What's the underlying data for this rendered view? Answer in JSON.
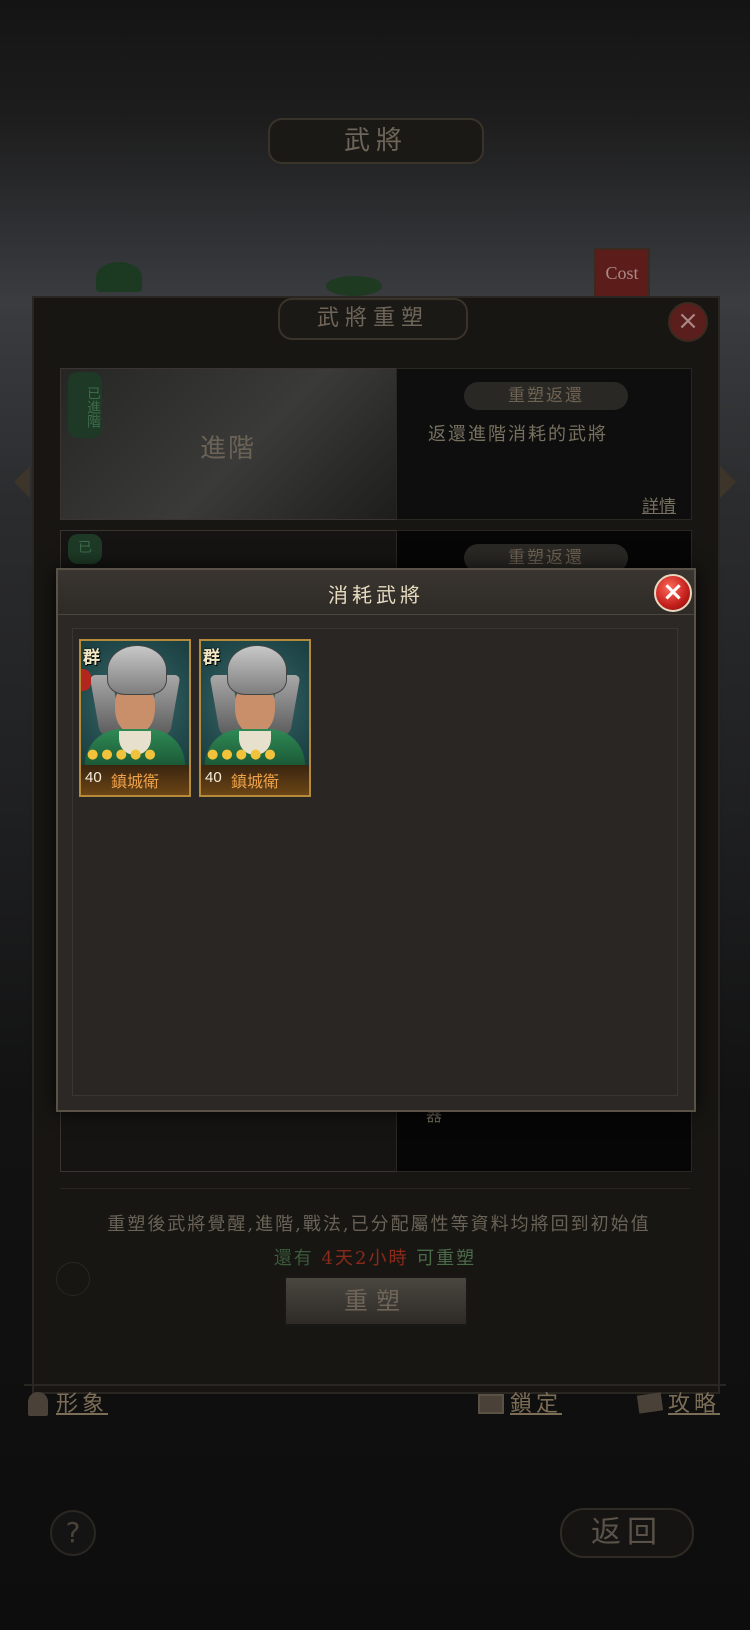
{
  "header": {
    "title": "武將"
  },
  "cost_badge": "Cost",
  "panel": {
    "title": "武將重塑",
    "card1": {
      "tag": "已進階",
      "left_label": "進階",
      "pill": "重塑返還",
      "desc": "返還進階消耗的武將",
      "details": "詳情"
    },
    "card2": {
      "tag": "已",
      "pill": "重塑返還",
      "partial": "器"
    },
    "notice": "重塑後武將覺醒,進階,戰法,已分配屬性等資料均將回到初始值",
    "timer": {
      "prefix": "還有",
      "time": "4天2小時",
      "suffix": "可重塑"
    },
    "button": "重塑"
  },
  "bottom_bar": {
    "image": "形象",
    "lock": "鎖定",
    "guide": "攻略"
  },
  "footer": {
    "help": "?",
    "back": "返回"
  },
  "modal": {
    "title": "消耗武將",
    "close": "×",
    "generals": [
      {
        "faction": "群",
        "stars": "●●●●●",
        "level": "40",
        "name": "鎮城衛"
      },
      {
        "faction": "群",
        "stars": "●●●●●",
        "level": "40",
        "name": "鎮城衛"
      }
    ]
  },
  "colors": {
    "accent_gold": "#b58a3a",
    "close_red": "#c21e1a",
    "timer_red": "#8a2a1a",
    "timer_green": "#3a5a3a"
  }
}
